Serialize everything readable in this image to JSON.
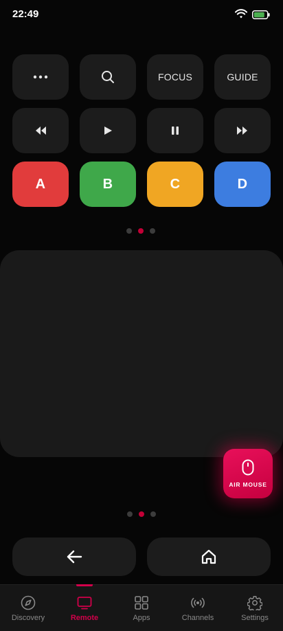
{
  "status_bar": {
    "time": "22:49",
    "wifi_icon": "wifi-icon",
    "battery_icon": "battery-icon",
    "battery_color": "#4caf50"
  },
  "controls": {
    "row1": [
      {
        "id": "more",
        "label": "",
        "icon": "more-horizontal-icon"
      },
      {
        "id": "search",
        "label": "",
        "icon": "search-icon"
      },
      {
        "id": "focus",
        "label": "FOCUS",
        "icon": ""
      },
      {
        "id": "guide",
        "label": "GUIDE",
        "icon": ""
      }
    ],
    "row2": [
      {
        "id": "rewind",
        "label": "",
        "icon": "rewind-icon"
      },
      {
        "id": "play",
        "label": "",
        "icon": "play-icon"
      },
      {
        "id": "pause",
        "label": "",
        "icon": "pause-icon"
      },
      {
        "id": "fast-forward",
        "label": "",
        "icon": "fast-forward-icon"
      }
    ],
    "color_buttons": [
      {
        "label": "A",
        "color": "#e13c3c"
      },
      {
        "label": "B",
        "color": "#3fa84a"
      },
      {
        "label": "C",
        "color": "#f0a623"
      },
      {
        "label": "D",
        "color": "#3d7de0"
      }
    ]
  },
  "pager_top": {
    "count": 3,
    "active_index": 1
  },
  "pager_bottom": {
    "count": 3,
    "active_index": 1
  },
  "air_mouse": {
    "label": "AIR MOUSE",
    "icon": "mouse-icon"
  },
  "nav": {
    "back_icon": "arrow-left-icon",
    "home_icon": "home-icon"
  },
  "tabs": [
    {
      "label": "Discovery",
      "icon": "compass-icon",
      "active": false
    },
    {
      "label": "Remote",
      "icon": "tv-icon",
      "active": true
    },
    {
      "label": "Apps",
      "icon": "apps-grid-icon",
      "active": false
    },
    {
      "label": "Channels",
      "icon": "broadcast-icon",
      "active": false
    },
    {
      "label": "Settings",
      "icon": "gear-icon",
      "active": false
    }
  ],
  "accent_color": "#d2004a"
}
